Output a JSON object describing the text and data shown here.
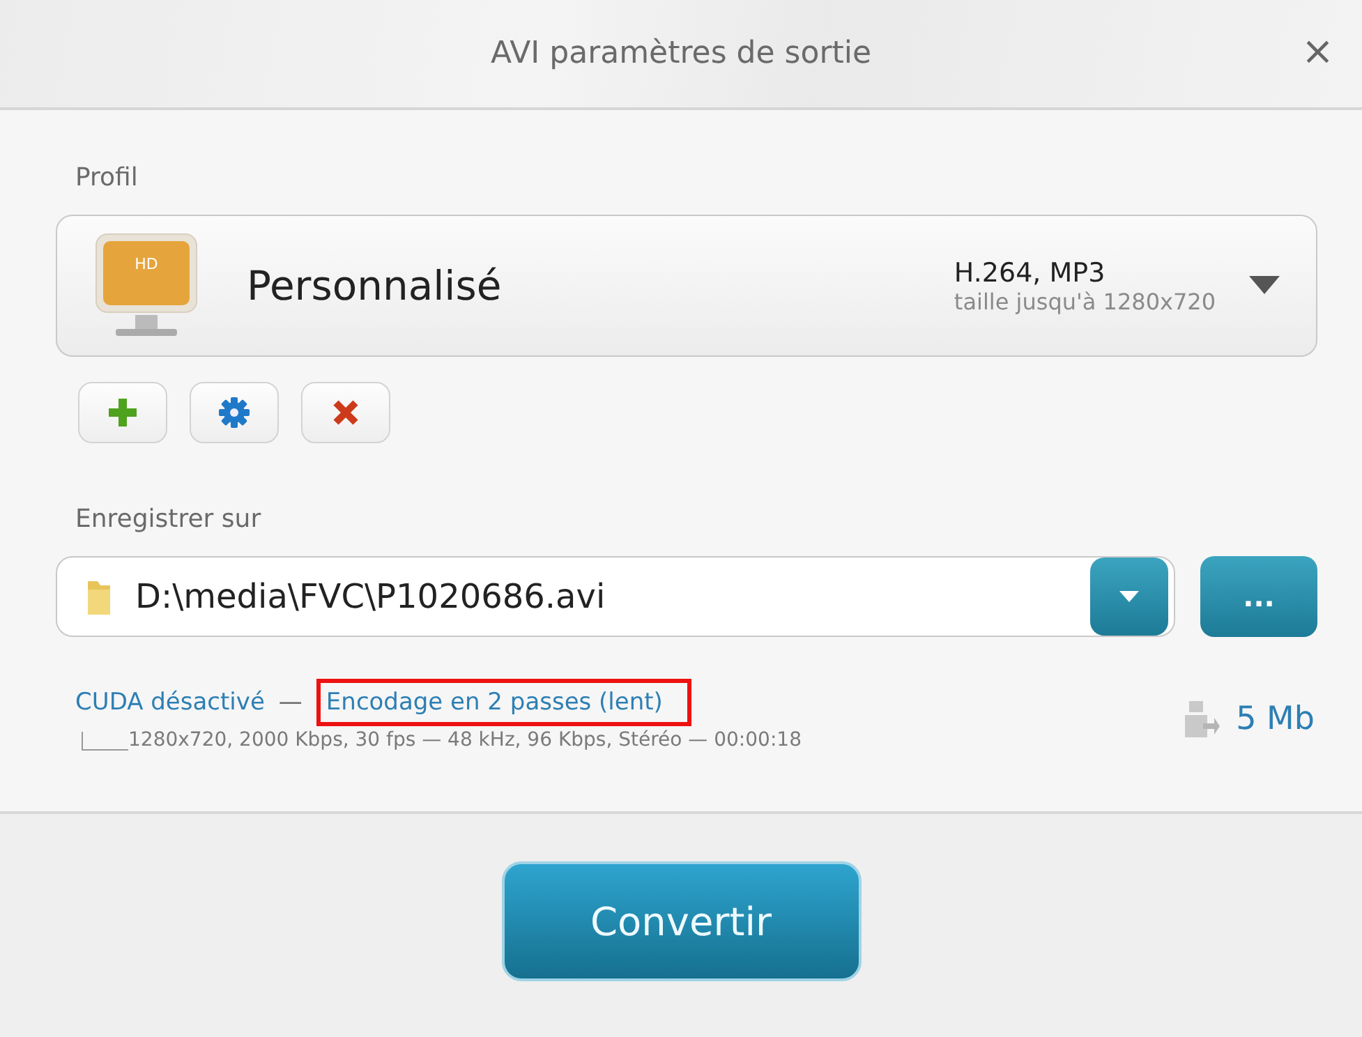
{
  "window": {
    "title": "AVI paramètres de sortie",
    "close": "×"
  },
  "profile": {
    "label": "Profil",
    "icon_label": "HD",
    "name": "Personnalisé",
    "codecs": "H.264, MP3",
    "size": "taille jusqu'à 1280x720"
  },
  "save": {
    "label": "Enregistrer sur",
    "path": "D:\\media\\FVC\\P1020686.avi",
    "browse": "..."
  },
  "options": [
    {
      "text": "CUDA désactivé",
      "highlighted": false
    },
    {
      "text": "Encodage en 2 passes (lent)",
      "highlighted": true
    }
  ],
  "separator": "—",
  "details": "1280x720, 2000 Kbps, 30 fps — 48 kHz, 96 Kbps, Stéréo — 00:00:18",
  "file_size": "5 Mb",
  "convert": "Convertir"
}
